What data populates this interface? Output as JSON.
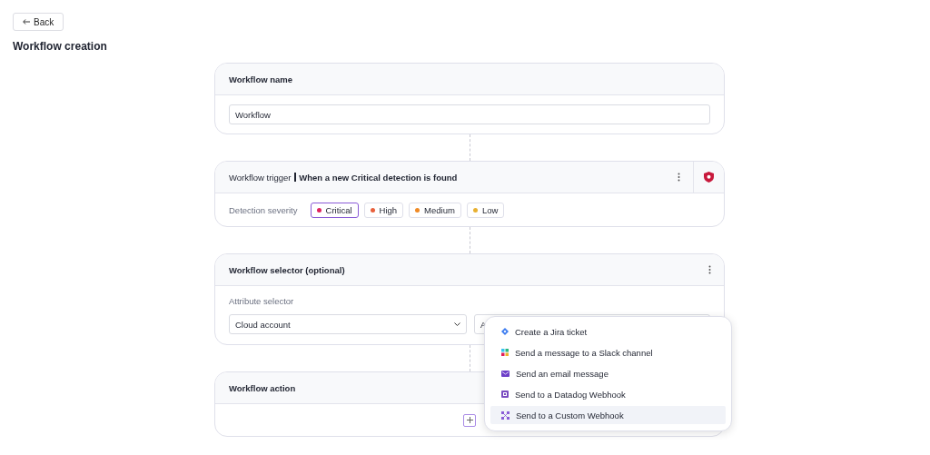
{
  "back_button": {
    "label": "Back"
  },
  "page_title": "Workflow creation",
  "name_card": {
    "title": "Workflow name",
    "field_value": "Workflow"
  },
  "trigger_card": {
    "title": "Workflow trigger",
    "title_detail": "When a new Critical detection is found",
    "severity_label": "Detection severity",
    "severities": [
      {
        "label": "Critical",
        "color": "#e0245e",
        "selected": true
      },
      {
        "label": "High",
        "color": "#e8603c",
        "selected": false
      },
      {
        "label": "Medium",
        "color": "#f08a24",
        "selected": false
      },
      {
        "label": "Low",
        "color": "#e8b030",
        "selected": false
      }
    ]
  },
  "selector_card": {
    "title": "Workflow selector (optional)",
    "attribute_label": "Attribute selector",
    "attribute_value": "Cloud account",
    "second_value": "A"
  },
  "action_card": {
    "title": "Workflow action"
  },
  "action_menu": [
    {
      "kind": "jira",
      "label": "Create a Jira ticket",
      "selected": false
    },
    {
      "kind": "slack",
      "label": "Send a message to a Slack channel",
      "selected": false
    },
    {
      "kind": "email",
      "label": "Send an email message",
      "selected": false
    },
    {
      "kind": "datadog",
      "label": "Send to a Datadog Webhook",
      "selected": false
    },
    {
      "kind": "webhook",
      "label": "Send to a Custom Webhook",
      "selected": true
    }
  ]
}
